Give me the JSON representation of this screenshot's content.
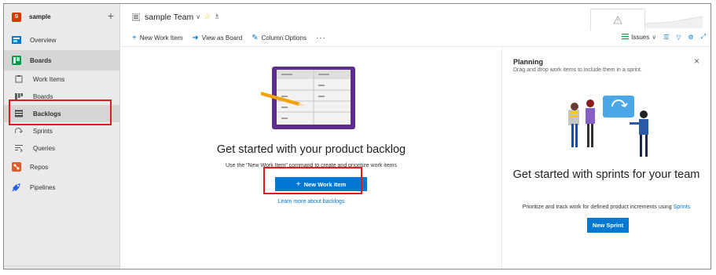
{
  "sidebar": {
    "project_initial": "S",
    "project_name": "sample",
    "add_label": "+",
    "items": [
      {
        "label": "Overview",
        "icon": "overview-icon"
      },
      {
        "label": "Boards",
        "icon": "boards-icon"
      },
      {
        "label": "Repos",
        "icon": "repos-icon"
      },
      {
        "label": "Pipelines",
        "icon": "pipelines-icon"
      }
    ],
    "boards_sub": [
      {
        "label": "Work Items",
        "icon": "work-items-icon"
      },
      {
        "label": "Boards",
        "icon": "board-icon"
      },
      {
        "label": "Backlogs",
        "icon": "backlogs-icon"
      },
      {
        "label": "Sprints",
        "icon": "sprints-icon"
      },
      {
        "label": "Queries",
        "icon": "queries-icon"
      }
    ]
  },
  "header": {
    "team_title": "sample Team",
    "chevron": "∨",
    "star": "☆",
    "people": "♗"
  },
  "toolbar": {
    "new_work_item": "New Work Item",
    "view_as_board": "View as Board",
    "column_options": "Column Options",
    "more": "···",
    "issues": "Issues",
    "issues_chevron": "∨"
  },
  "content": {
    "headline": "Get started with your product backlog",
    "description": "Use the \"New Work Item\" command to create and prioritize work items",
    "button_label": "New Work Item",
    "button_plus": "+",
    "learn_more": "Learn more about backlogs"
  },
  "planning": {
    "title": "Planning",
    "close": "×",
    "description": "Drag and drop work items to include them in a sprint.",
    "headline": "Get started with sprints for your team",
    "subtext": "Prioritize and track work for defined product increments using",
    "subtext_link": "Sprints",
    "button_label": "New Sprint"
  },
  "colors": {
    "accent": "#0078d4",
    "project_badge": "#d83b01",
    "highlight": "#e31a1a",
    "sidebar_bg": "#eaeaea"
  }
}
